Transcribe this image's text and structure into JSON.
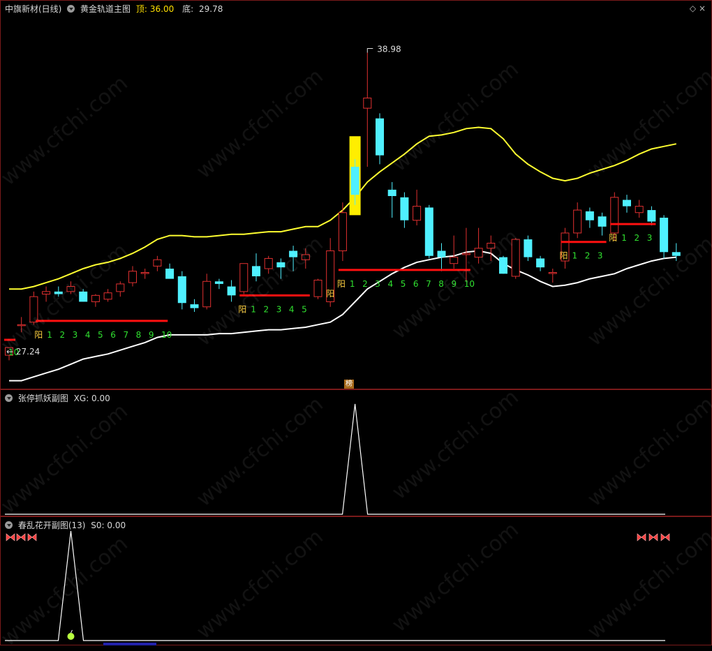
{
  "main_header": {
    "title": "中旗新材(日线)",
    "indicator": "黄金轨道主图",
    "top_label": "顶:",
    "top_value": "36.00",
    "bottom_label": "底:",
    "bottom_value": "29.78"
  },
  "sub1_header": {
    "title": "张停抓妖副图",
    "metric": "XG: 0.00"
  },
  "sub2_header": {
    "title": "春乱花开副图(13)",
    "metric": "S0: 0.00"
  },
  "top_right_icons": [
    "diamond-icon",
    "close-icon"
  ],
  "bang_label": "榜",
  "watermark": "www.cfchi.com",
  "annotations": {
    "high_label": "38.98",
    "low_label": "27.24",
    "yang_label": "阳",
    "counter_first": "10"
  },
  "counters": [
    {
      "yang": "阳",
      "nums": [
        "1",
        "2",
        "3",
        "4",
        "5",
        "6",
        "7",
        "8",
        "9",
        "10"
      ],
      "start_idx": 2
    },
    {
      "yang": "阳",
      "nums": [
        "1",
        "2",
        "3",
        "4",
        "5"
      ],
      "start_idx": 19
    },
    {
      "yang": "阳",
      "nums": [
        "1",
        "2",
        "3",
        "4",
        "5",
        "6",
        "7",
        "8",
        "9",
        "10"
      ],
      "start_idx": 27
    },
    {
      "yang": "阳",
      "nums": [
        "1",
        "2",
        "3"
      ],
      "start_idx": 45
    },
    {
      "yang": "阳",
      "nums": [
        "1",
        "2",
        "3"
      ],
      "start_idx": 49
    }
  ],
  "colors": {
    "up": "#e03030",
    "down": "#4ff0ff",
    "upper_band": "#ffff30",
    "lower_band": "#ffffff",
    "red_bar": "#ff1010",
    "counter_num": "#30e030",
    "yang": "#ffd040"
  },
  "chart_data": {
    "type": "candlestick",
    "ylim": [
      26.5,
      40.2
    ],
    "candles": [
      {
        "o": 27.1,
        "h": 27.4,
        "l": 26.9,
        "c": 27.4
      },
      {
        "o": 28.3,
        "h": 28.6,
        "l": 28.0,
        "c": 28.3
      },
      {
        "o": 28.4,
        "h": 29.6,
        "l": 28.3,
        "c": 29.4
      },
      {
        "o": 29.5,
        "h": 29.8,
        "l": 29.2,
        "c": 29.6
      },
      {
        "o": 29.6,
        "h": 29.8,
        "l": 29.4,
        "c": 29.5
      },
      {
        "o": 29.6,
        "h": 30.0,
        "l": 29.5,
        "c": 29.8
      },
      {
        "o": 29.6,
        "h": 29.7,
        "l": 29.2,
        "c": 29.2
      },
      {
        "o": 29.2,
        "h": 29.5,
        "l": 29.0,
        "c": 29.45
      },
      {
        "o": 29.3,
        "h": 29.7,
        "l": 29.2,
        "c": 29.55
      },
      {
        "o": 29.6,
        "h": 30.0,
        "l": 29.4,
        "c": 29.9
      },
      {
        "o": 29.95,
        "h": 30.6,
        "l": 29.8,
        "c": 30.4
      },
      {
        "o": 30.35,
        "h": 30.5,
        "l": 30.1,
        "c": 30.35
      },
      {
        "o": 30.6,
        "h": 31.0,
        "l": 30.4,
        "c": 30.85
      },
      {
        "o": 30.5,
        "h": 30.7,
        "l": 30.2,
        "c": 30.1
      },
      {
        "o": 30.2,
        "h": 30.4,
        "l": 28.9,
        "c": 29.15
      },
      {
        "o": 29.1,
        "h": 29.3,
        "l": 28.8,
        "c": 28.95
      },
      {
        "o": 29.0,
        "h": 30.3,
        "l": 28.9,
        "c": 30.0
      },
      {
        "o": 30.0,
        "h": 30.1,
        "l": 29.7,
        "c": 29.9
      },
      {
        "o": 29.8,
        "h": 30.05,
        "l": 29.2,
        "c": 29.45
      },
      {
        "o": 29.6,
        "h": 30.7,
        "l": 29.5,
        "c": 30.7
      },
      {
        "o": 30.6,
        "h": 31.1,
        "l": 30.0,
        "c": 30.2
      },
      {
        "o": 30.5,
        "h": 31.0,
        "l": 30.3,
        "c": 30.9
      },
      {
        "o": 30.75,
        "h": 30.9,
        "l": 30.1,
        "c": 30.55
      },
      {
        "o": 31.2,
        "h": 31.4,
        "l": 30.4,
        "c": 30.95
      },
      {
        "o": 30.85,
        "h": 31.3,
        "l": 30.5,
        "c": 31.05
      },
      {
        "o": 29.4,
        "h": 30.1,
        "l": 29.3,
        "c": 30.05
      },
      {
        "o": 29.2,
        "h": 31.7,
        "l": 29.0,
        "c": 31.2
      },
      {
        "o": 31.2,
        "h": 33.1,
        "l": 30.8,
        "c": 32.7
      },
      {
        "o": 34.5,
        "h": 34.8,
        "l": 33.0,
        "c": 33.4
      },
      {
        "o": 36.8,
        "h": 38.98,
        "l": 34.5,
        "c": 37.2
      },
      {
        "o": 36.4,
        "h": 36.6,
        "l": 34.6,
        "c": 34.95
      },
      {
        "o": 33.6,
        "h": 33.9,
        "l": 32.5,
        "c": 33.35
      },
      {
        "o": 33.3,
        "h": 33.5,
        "l": 32.1,
        "c": 32.4
      },
      {
        "o": 32.4,
        "h": 33.6,
        "l": 32.2,
        "c": 32.95
      },
      {
        "o": 32.9,
        "h": 33.0,
        "l": 30.9,
        "c": 31.0
      },
      {
        "o": 31.2,
        "h": 31.5,
        "l": 30.4,
        "c": 30.95
      },
      {
        "o": 30.7,
        "h": 31.8,
        "l": 30.5,
        "c": 30.95
      },
      {
        "o": 31.05,
        "h": 32.1,
        "l": 30.0,
        "c": 31.1
      },
      {
        "o": 30.95,
        "h": 32.1,
        "l": 30.7,
        "c": 31.3
      },
      {
        "o": 31.3,
        "h": 31.8,
        "l": 30.8,
        "c": 31.5
      },
      {
        "o": 30.95,
        "h": 31.0,
        "l": 30.3,
        "c": 30.3
      },
      {
        "o": 30.2,
        "h": 31.7,
        "l": 30.1,
        "c": 31.65
      },
      {
        "o": 31.65,
        "h": 31.8,
        "l": 30.8,
        "c": 30.95
      },
      {
        "o": 30.9,
        "h": 31.0,
        "l": 30.4,
        "c": 30.55
      },
      {
        "o": 30.35,
        "h": 30.5,
        "l": 29.95,
        "c": 30.35
      },
      {
        "o": 30.8,
        "h": 32.1,
        "l": 30.5,
        "c": 31.9
      },
      {
        "o": 31.9,
        "h": 33.1,
        "l": 31.7,
        "c": 32.8
      },
      {
        "o": 32.75,
        "h": 32.9,
        "l": 32.1,
        "c": 32.4
      },
      {
        "o": 32.55,
        "h": 32.7,
        "l": 31.8,
        "c": 32.15
      },
      {
        "o": 31.9,
        "h": 33.5,
        "l": 31.6,
        "c": 33.3
      },
      {
        "o": 33.2,
        "h": 33.4,
        "l": 32.7,
        "c": 32.95
      },
      {
        "o": 32.7,
        "h": 33.2,
        "l": 32.5,
        "c": 32.95
      },
      {
        "o": 32.8,
        "h": 32.95,
        "l": 32.2,
        "c": 32.35
      },
      {
        "o": 32.5,
        "h": 32.6,
        "l": 30.9,
        "c": 31.15
      },
      {
        "o": 31.15,
        "h": 31.5,
        "l": 30.8,
        "c": 31.0
      }
    ],
    "upper_band": [
      29.7,
      29.7,
      29.8,
      29.95,
      30.1,
      30.3,
      30.5,
      30.65,
      30.75,
      30.9,
      31.1,
      31.35,
      31.65,
      31.8,
      31.8,
      31.75,
      31.75,
      31.8,
      31.85,
      31.85,
      31.9,
      31.95,
      31.95,
      32.05,
      32.15,
      32.15,
      32.4,
      32.8,
      33.3,
      33.9,
      34.3,
      34.65,
      35.0,
      35.4,
      35.7,
      35.75,
      35.85,
      36.0,
      36.05,
      36.0,
      35.6,
      35.0,
      34.6,
      34.3,
      34.05,
      33.95,
      34.05,
      34.25,
      34.4,
      34.55,
      34.75,
      35.0,
      35.2,
      35.3,
      35.4
    ],
    "lower_band": [
      26.1,
      26.1,
      26.25,
      26.4,
      26.55,
      26.75,
      26.95,
      27.05,
      27.15,
      27.3,
      27.45,
      27.6,
      27.8,
      27.9,
      27.9,
      27.9,
      27.9,
      27.95,
      27.95,
      28.0,
      28.05,
      28.1,
      28.1,
      28.15,
      28.2,
      28.3,
      28.4,
      28.7,
      29.2,
      29.7,
      30.0,
      30.3,
      30.55,
      30.75,
      30.85,
      30.95,
      31.0,
      31.15,
      31.2,
      31.1,
      30.7,
      30.45,
      30.25,
      30.0,
      29.8,
      29.85,
      29.95,
      30.1,
      30.2,
      30.3,
      30.5,
      30.65,
      30.8,
      30.9,
      30.95
    ],
    "signal_bar": {
      "idx": 28,
      "low": 32.6,
      "high": 35.7
    },
    "red_bars": [
      {
        "from": 2.5,
        "to": 12.5,
        "value": 28.45
      },
      {
        "from": 19,
        "to": 24,
        "value": 29.45
      },
      {
        "from": 27,
        "to": 37,
        "value": 30.45
      },
      {
        "from": 45,
        "to": 48,
        "value": 31.55
      },
      {
        "from": 49,
        "to": 52,
        "value": 32.25
      }
    ],
    "sub1": {
      "ylim": [
        0,
        1
      ],
      "peak_idx": 28,
      "metric": "XG"
    },
    "sub2": {
      "ylim": [
        0,
        1
      ],
      "peak_idx": 5,
      "metric": "S0"
    }
  }
}
